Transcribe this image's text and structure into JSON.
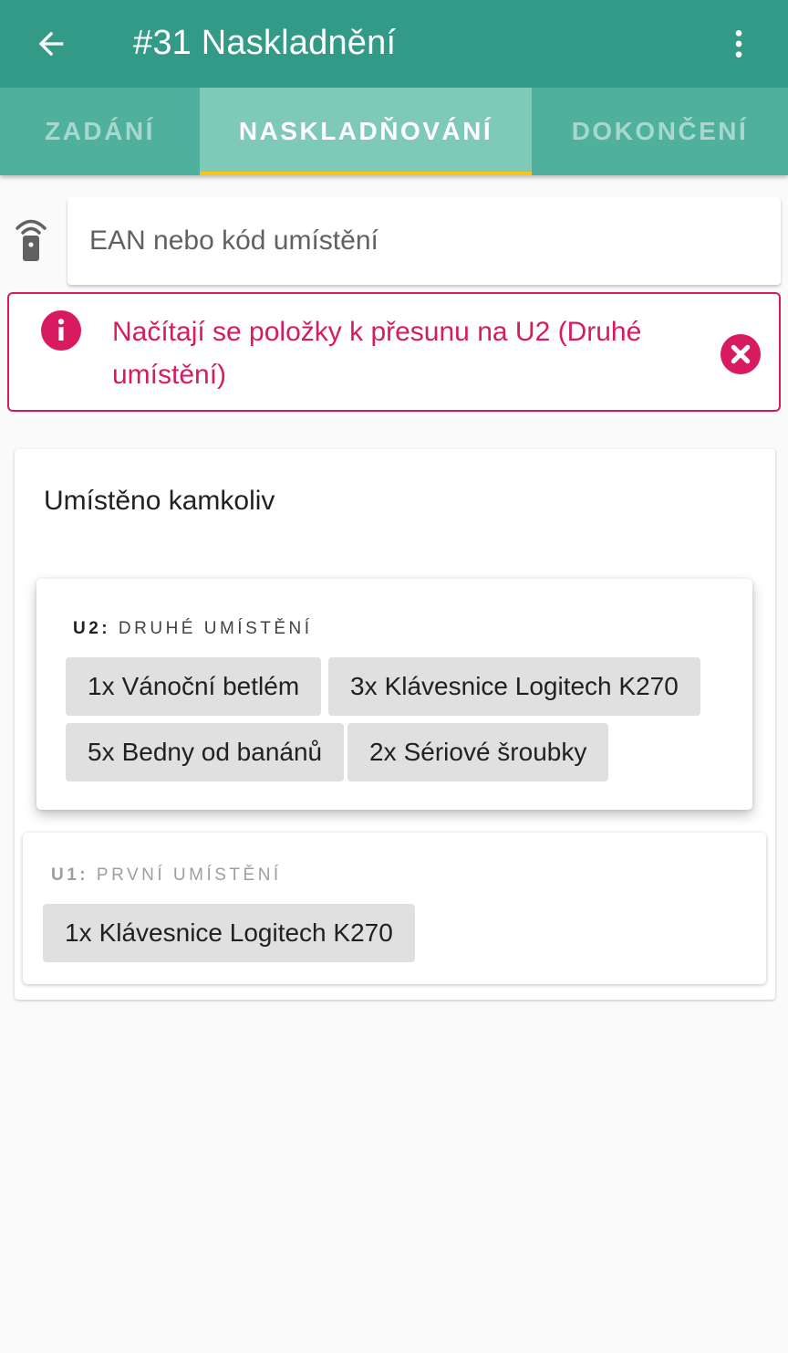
{
  "appbar": {
    "title": "#31 Naskladnění",
    "back_icon": "arrow-left-icon",
    "menu_icon": "more-vertical-icon",
    "color": "#339a87"
  },
  "tabs": [
    {
      "label": "ZADÁNÍ",
      "active": false
    },
    {
      "label": "NASKLADŇOVÁNÍ",
      "active": true
    },
    {
      "label": "DOKONČENÍ",
      "active": false
    }
  ],
  "search": {
    "placeholder": "EAN nebo kód umístění",
    "value": "",
    "icon": "scanner-icon"
  },
  "alert": {
    "text": "Načítají se položky k přesunu na U2 (Druhé umístění)",
    "icon": "info-icon",
    "close_icon": "close-circle-icon",
    "color": "#d81b60"
  },
  "main": {
    "title": "Umístěno kamkoliv",
    "locations": [
      {
        "code": "U2",
        "name": "DRUHÉ UMÍSTĚNÍ",
        "items": [
          {
            "qty": "1x",
            "name": "Vánoční betlém"
          },
          {
            "qty": "3x",
            "name": "Klávesnice Logitech K270"
          },
          {
            "qty": "5x",
            "name": "Bedny od banánů"
          },
          {
            "qty": "2x",
            "name": "Sériové šroubky"
          }
        ]
      },
      {
        "code": "U1",
        "name": "PRVNÍ UMÍSTĚNÍ",
        "items": [
          {
            "qty": "1x",
            "name": "Klávesnice Logitech K270"
          }
        ]
      }
    ]
  }
}
